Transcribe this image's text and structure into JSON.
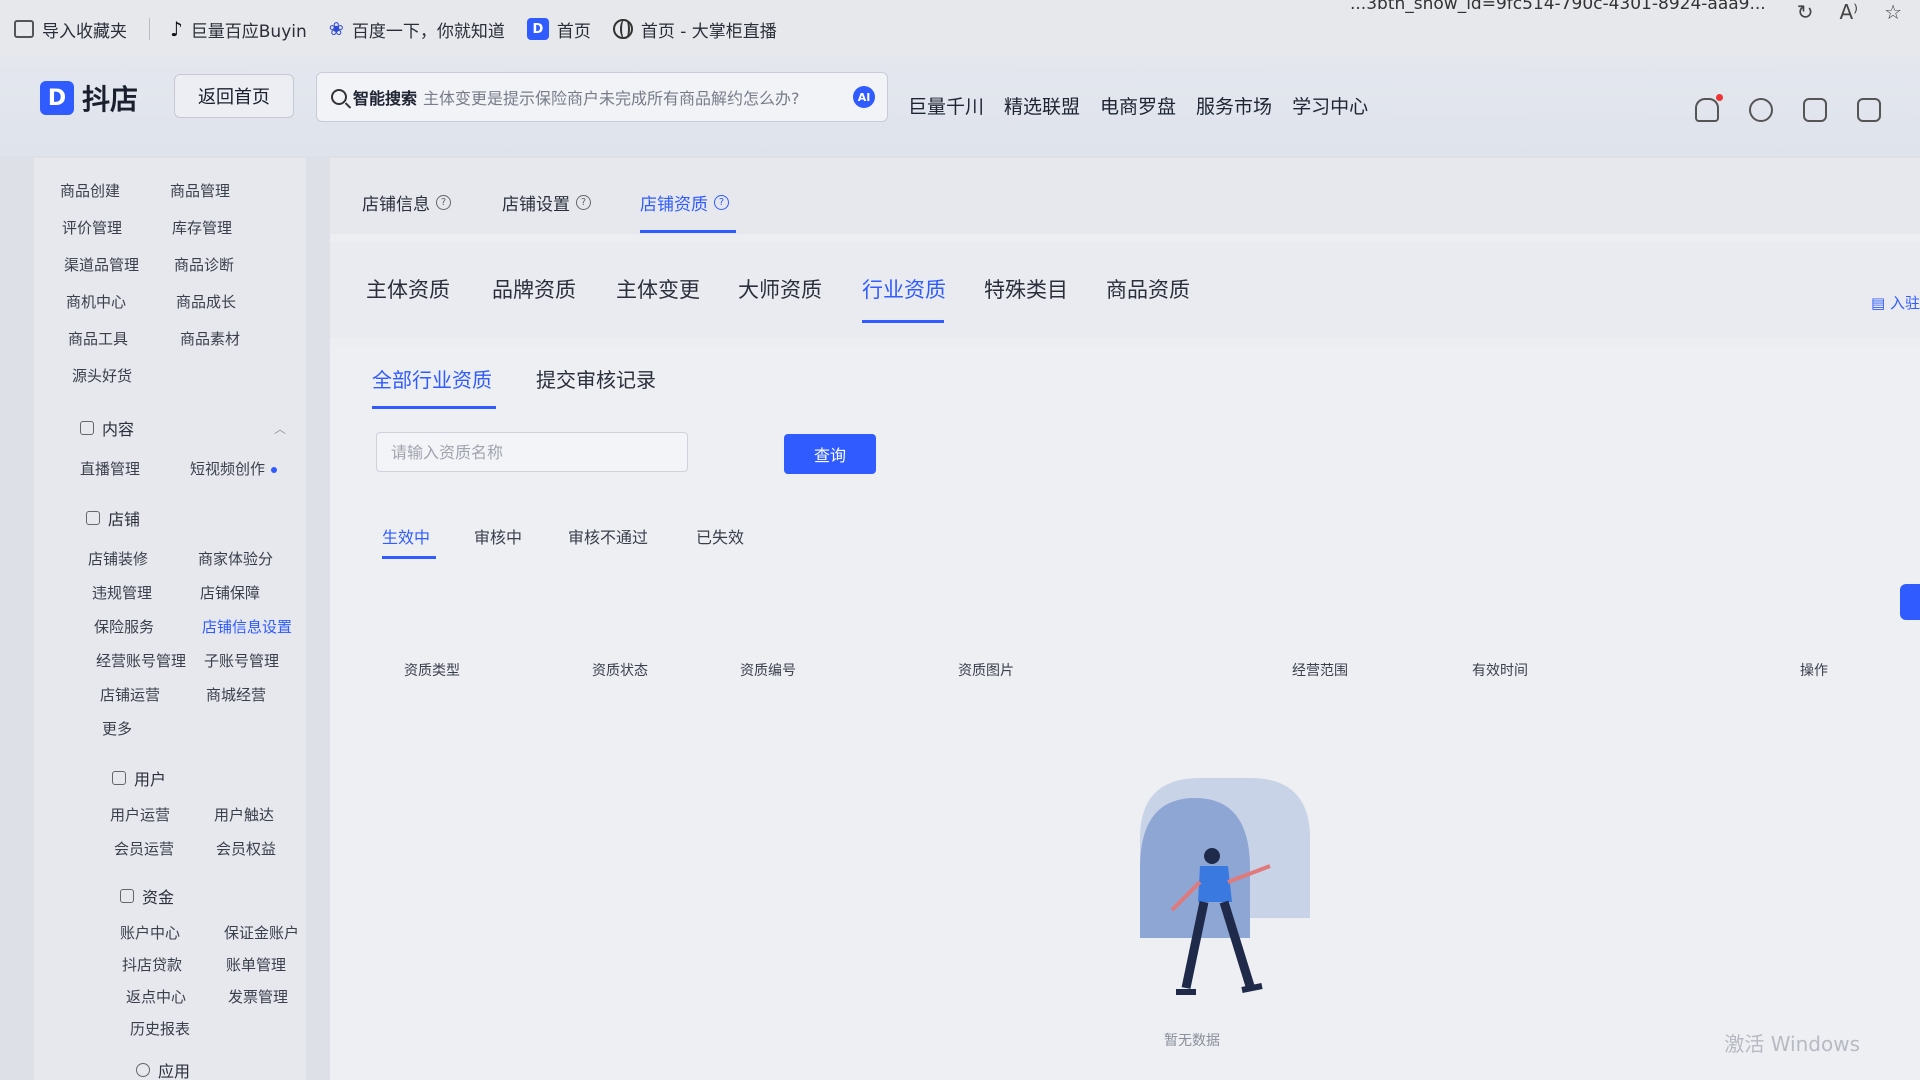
{
  "bookmarks": [
    {
      "label": "导入收藏夹",
      "icon": "import-icon"
    },
    {
      "label": "巨量百应Buyin",
      "icon": "tiktok-icon"
    },
    {
      "label": "百度一下，你就知道",
      "icon": "baidu-paw-icon"
    },
    {
      "label": "首页",
      "icon": "doudian-icon"
    },
    {
      "label": "首页 - 大掌柜直播",
      "icon": "globe-icon"
    }
  ],
  "url_tail": "...3bth_show_id=9fc514-790c-4301-8924-aaa9...",
  "header": {
    "logo_mark": "D",
    "logo_text": "抖店",
    "back_label": "返回首页",
    "search_label": "智能搜索",
    "search_placeholder": "主体变更是提示保险商户未完成所有商品解约怎么办?",
    "search_ai": "AI",
    "nav": [
      "巨量千川",
      "精选联盟",
      "电商罗盘",
      "服务市场",
      "学习中心"
    ]
  },
  "sidebar": {
    "goods": [
      "商品创建",
      "商品管理",
      "评价管理",
      "库存管理",
      "渠道品管理",
      "商品诊断",
      "商机中心",
      "商品成长",
      "商品工具",
      "商品素材",
      "源头好货"
    ],
    "content_group": "内容",
    "content": [
      "直播管理",
      "短视频创作"
    ],
    "shop_group": "店铺",
    "shop": [
      "店铺装修",
      "商家体验分",
      "违规管理",
      "店铺保障",
      "保险服务",
      "店铺信息设置",
      "经营账号管理",
      "子账号管理",
      "店铺运营",
      "商城经营",
      "更多"
    ],
    "user_group": "用户",
    "user": [
      "用户运营",
      "用户触达",
      "会员运营",
      "会员权益"
    ],
    "fund_group": "资金",
    "fund": [
      "账户中心",
      "保证金账户",
      "抖店贷款",
      "账单管理",
      "返点中心",
      "发票管理",
      "历史报表"
    ],
    "app_group": "应用"
  },
  "tabs_l1": [
    {
      "label": "店铺信息",
      "active": false
    },
    {
      "label": "店铺设置",
      "active": false
    },
    {
      "label": "店铺资质",
      "active": true
    }
  ],
  "tabs_l2": [
    "主体资质",
    "品牌资质",
    "主体变更",
    "大师资质",
    "行业资质",
    "特殊类目",
    "商品资质"
  ],
  "tabs_l2_active": "行业资质",
  "entry_link": "入驻",
  "tabs_l3": [
    "全部行业资质",
    "提交审核记录"
  ],
  "query": {
    "placeholder": "请输入资质名称",
    "button": "查询"
  },
  "status_tabs": [
    "生效中",
    "审核中",
    "审核不通过",
    "已失效"
  ],
  "table_headers": [
    "资质类型",
    "资质状态",
    "资质编号",
    "资质图片",
    "经营范围",
    "有效时间",
    "操作"
  ],
  "empty_text": "暂无数据",
  "watermark": "激活 Windows",
  "colors": {
    "accent": "#2f5bff"
  }
}
